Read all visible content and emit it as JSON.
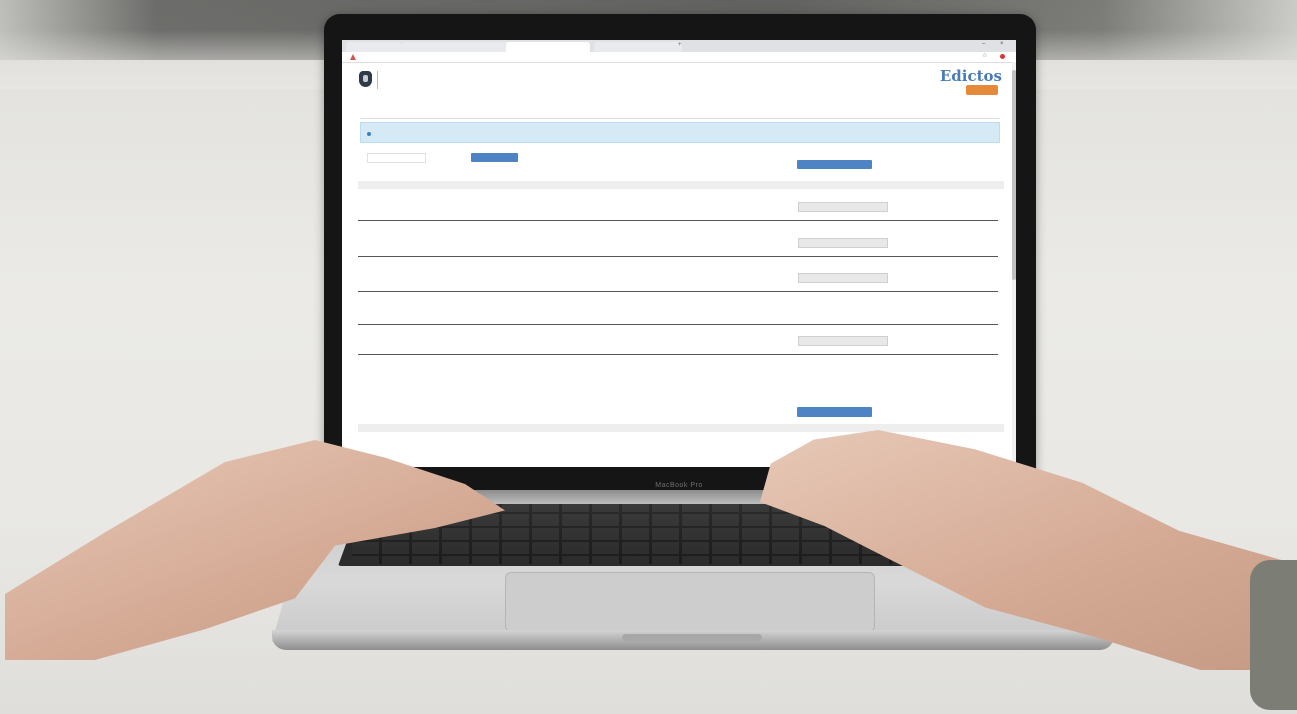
{
  "browser": {
    "tabs": [
      {
        "label": ""
      },
      {
        "label": ""
      },
      {
        "label": ""
      },
      {
        "label": ""
      }
    ],
    "address": ""
  },
  "site": {
    "court_name": "",
    "court_sub": "",
    "brand": "Edictos",
    "brand_button": "",
    "page_title": ""
  },
  "alert": {
    "text": ""
  },
  "filter": {
    "label": "",
    "value": "",
    "button": ""
  },
  "sections": [
    {
      "title": "",
      "subtitle": "",
      "header": "",
      "button": ""
    },
    {
      "title": "",
      "subtitle": "",
      "header": "",
      "button": ""
    }
  ],
  "rows": [
    {
      "date": "",
      "name": "",
      "action": ""
    },
    {
      "date": "",
      "name": "",
      "action": ""
    },
    {
      "date": "",
      "name": "",
      "action": ""
    },
    {
      "date": "",
      "name": "",
      "action": ""
    },
    {
      "date": "",
      "name": "",
      "action": ""
    },
    {
      "date": "",
      "name": "",
      "action": ""
    }
  ],
  "laptop": {
    "model_label": "MacBook Pro"
  },
  "colors": {
    "brand_blue": "#4a7bb7",
    "accent_orange": "#e58a3a",
    "alert_bg": "#d6eaf5"
  }
}
